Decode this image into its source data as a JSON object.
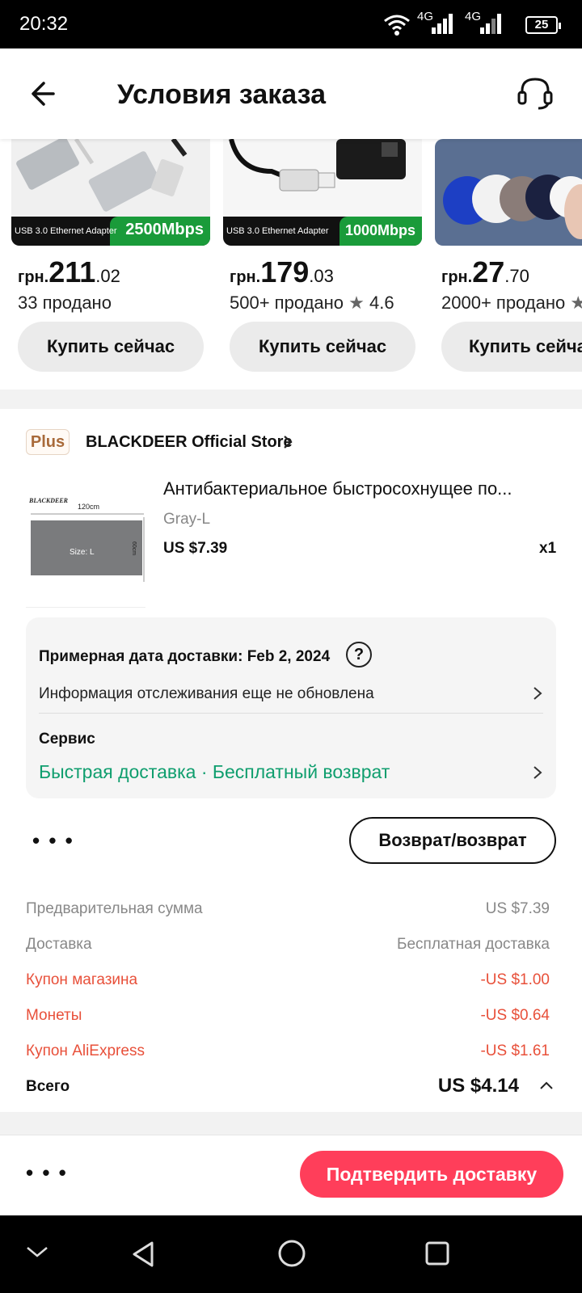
{
  "status_bar": {
    "time": "20:32",
    "network_1": "4G",
    "network_2": "4G",
    "battery": "25"
  },
  "header": {
    "title": "Условия заказа",
    "back_icon": "back-arrow-icon",
    "support_icon": "headset-icon"
  },
  "products": [
    {
      "currency": "грн.",
      "price_int": "211",
      "price_dec": ".02",
      "sold": "33 продано",
      "rating": "",
      "buy_label": "Купить сейчас",
      "tag_small": "USB 3.0 Ethernet Adapter",
      "tag_big": "2500Mbps",
      "tag_color": "#1a9b3a"
    },
    {
      "currency": "грн.",
      "price_int": "179",
      "price_dec": ".03",
      "sold": "500+ продано",
      "rating": "4.6",
      "buy_label": "Купить сейчас",
      "tag_small": "USB 3.0 Ethernet Adapter",
      "tag_big": "1000Mbps",
      "tag_color": "#1a9b3a"
    },
    {
      "currency": "грн.",
      "price_int": "27",
      "price_dec": ".70",
      "sold": "2000+ продано",
      "rating": "",
      "buy_label": "Купить сейчас"
    }
  ],
  "store": {
    "badge": "Plus",
    "name": "BLACKDEER Official Store"
  },
  "item": {
    "title": "Антибактериальное быстросохнущее по...",
    "variant": "Gray-L",
    "price": "US $7.39",
    "qty": "x1",
    "thumb_brand": "BLACKDEER",
    "thumb_width": "120cm",
    "thumb_size": "Size: L",
    "thumb_height": "60cm"
  },
  "delivery": {
    "estimated": "Примерная дата доставки: Feb 2, 2024",
    "help_icon": "question-icon",
    "tracking": "Информация отслеживания еще не обновлена",
    "service_label": "Сервис",
    "service_value": "Быстрая доставка · Бесплатный возврат"
  },
  "actions": {
    "more": "• • •",
    "return_label": "Возврат/возврат",
    "confirm_label": "Подтвердить доставку"
  },
  "summary": [
    {
      "label": "Предварительная сумма",
      "value": "US $7.39",
      "style": "grey"
    },
    {
      "label": "Доставка",
      "value": "Бесплатная доставка",
      "style": "grey"
    },
    {
      "label": "Купон магазина",
      "value": "-US $1.00",
      "style": "red"
    },
    {
      "label": "Монеты",
      "value": "-US $0.64",
      "style": "red"
    },
    {
      "label": "Купон AliExpress",
      "value": "-US $1.61",
      "style": "red"
    }
  ],
  "total": {
    "label": "Всего",
    "value": "US $4.14"
  },
  "colors": {
    "accent_red": "#ff3e5a",
    "discount_red": "#e8503a",
    "service_green": "#0f9e6e"
  }
}
